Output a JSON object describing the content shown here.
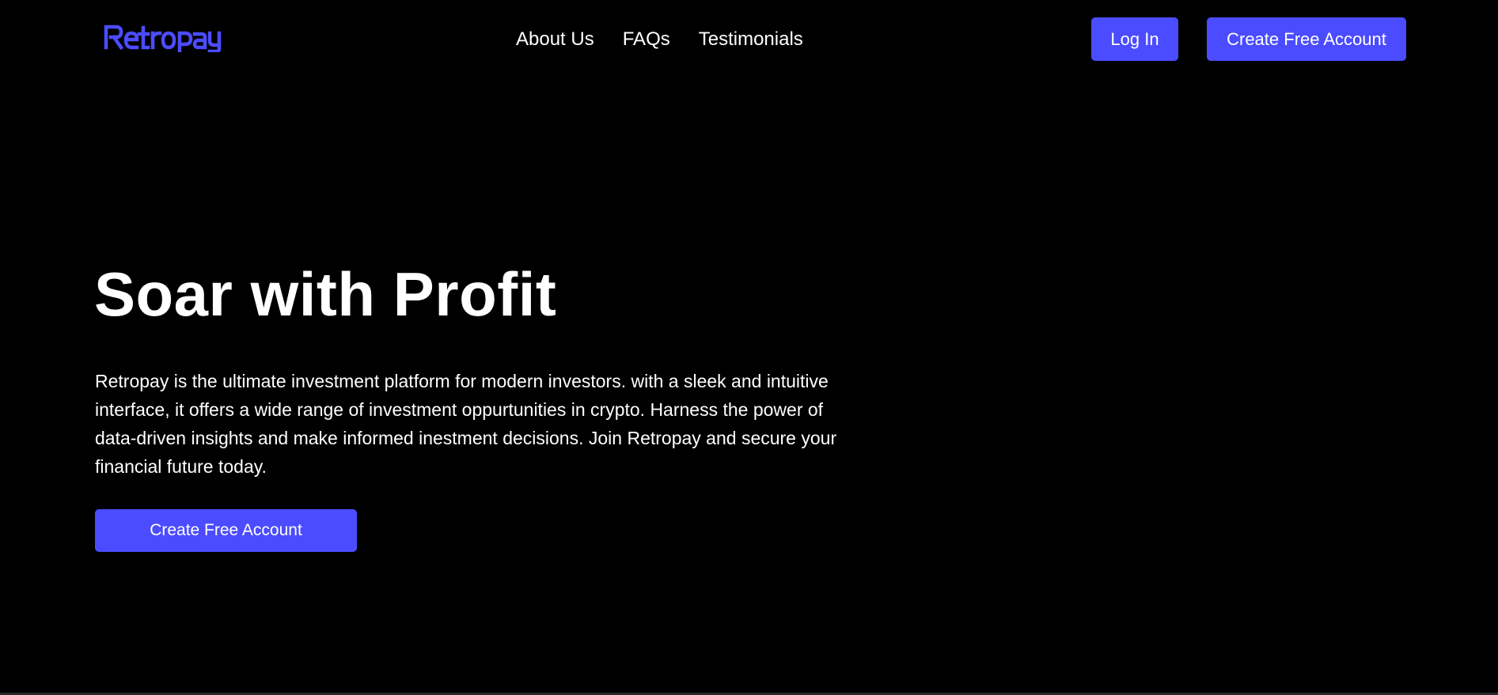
{
  "brand": {
    "name": "Retropay",
    "accent_color": "#4b4cff"
  },
  "nav": {
    "items": [
      {
        "label": "About Us"
      },
      {
        "label": "FAQs"
      },
      {
        "label": "Testimonials"
      }
    ]
  },
  "header": {
    "login_label": "Log In",
    "create_account_label": "Create Free Account"
  },
  "hero": {
    "title": "Soar with Profit",
    "description": "Retropay is the ultimate investment platform for modern investors. with a sleek and intuitive interface, it offers a wide range of investment oppurtunities in crypto. Harness the power of data-driven insights and make informed inestment decisions. Join Retropay and secure your financial future today.",
    "cta_label": "Create Free Account"
  }
}
